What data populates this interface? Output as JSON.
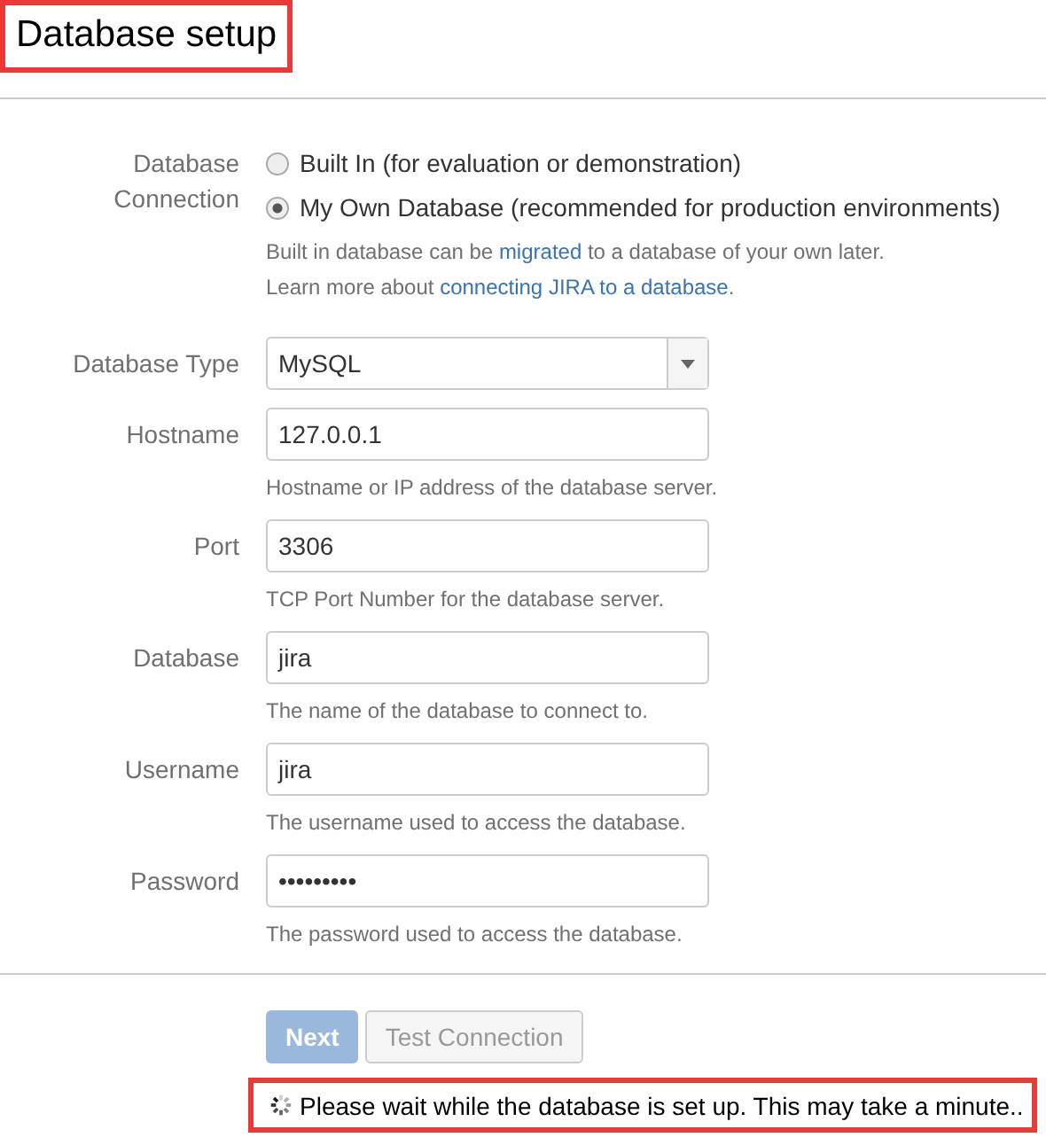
{
  "title": "Database setup",
  "connection": {
    "label": "Database Connection",
    "options": [
      {
        "label": "Built In (for evaluation or demonstration)",
        "selected": false
      },
      {
        "label": "My Own Database (recommended for production environments)",
        "selected": true
      }
    ],
    "notes": [
      {
        "before": "Built in database can be ",
        "link": "migrated",
        "after": " to a database of your own later."
      },
      {
        "before": "Learn more about ",
        "link": "connecting JIRA to a database",
        "after": "."
      }
    ]
  },
  "fields": [
    {
      "kind": "select",
      "label": "Database Type",
      "value": "MySQL"
    },
    {
      "kind": "text",
      "label": "Hostname",
      "value": "127.0.0.1",
      "help": "Hostname or IP address of the database server."
    },
    {
      "kind": "text",
      "label": "Port",
      "value": "3306",
      "help": "TCP Port Number for the database server."
    },
    {
      "kind": "text",
      "label": "Database",
      "value": "jira",
      "help": "The name of the database to connect to."
    },
    {
      "kind": "text",
      "label": "Username",
      "value": "jira",
      "help": "The username used to access the database."
    },
    {
      "kind": "password",
      "label": "Password",
      "value": "•••••••••",
      "help": "The password used to access the database."
    }
  ],
  "buttons": [
    {
      "label": "Next",
      "kind": "primary",
      "disabled": true
    },
    {
      "label": "Test Connection",
      "kind": "secondary",
      "disabled": true
    }
  ],
  "status": "Please wait while the database is set up. This may take a minute.."
}
